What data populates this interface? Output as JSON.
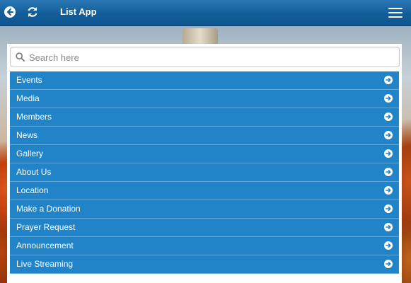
{
  "header": {
    "title": "List App",
    "back_icon": "back-arrow-circle-icon",
    "refresh_icon": "refresh-icon",
    "menu_icon": "hamburger-menu-icon"
  },
  "search": {
    "placeholder": "Search here",
    "value": "",
    "icon": "search-icon"
  },
  "list": {
    "items": [
      {
        "label": "Events"
      },
      {
        "label": "Media"
      },
      {
        "label": "Members"
      },
      {
        "label": "News"
      },
      {
        "label": "Gallery"
      },
      {
        "label": "About Us"
      },
      {
        "label": "Location"
      },
      {
        "label": "Make a Donation"
      },
      {
        "label": "Prayer Request"
      },
      {
        "label": "Announcement"
      },
      {
        "label": "Live Streaming"
      }
    ],
    "item_icon": "arrow-right-circle-icon"
  },
  "colors": {
    "header": "#125d98",
    "list_item": "#2184c9",
    "list_divider": "#5fa8de",
    "text_light": "#ffffff"
  }
}
